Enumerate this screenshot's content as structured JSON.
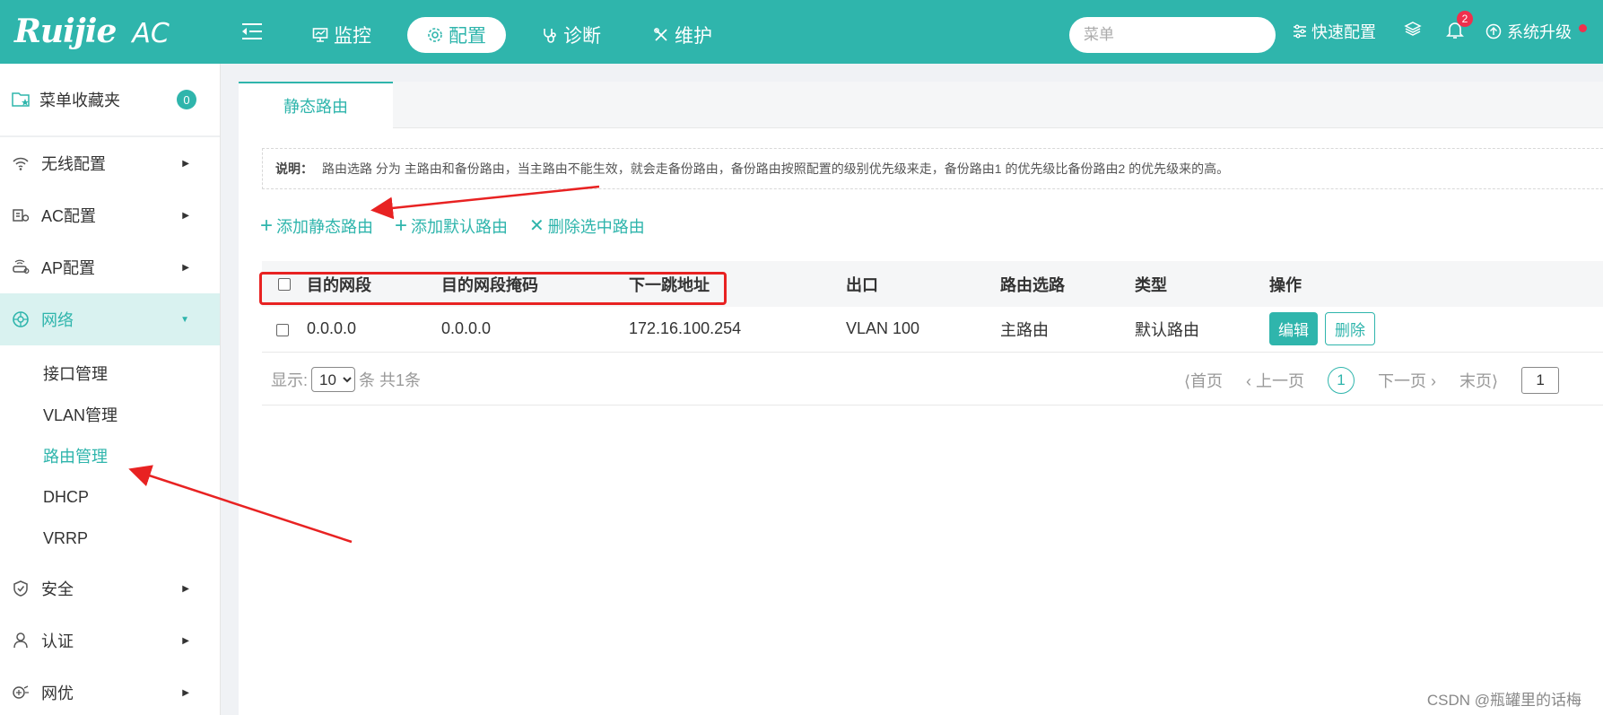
{
  "brand": {
    "logo": "Ruijie",
    "product": "AC"
  },
  "topnav": [
    {
      "label": "监控",
      "icon": "monitor-icon",
      "active": false
    },
    {
      "label": "配置",
      "icon": "gear-icon",
      "active": true
    },
    {
      "label": "诊断",
      "icon": "stethoscope-icon",
      "active": false
    },
    {
      "label": "维护",
      "icon": "tools-icon",
      "active": false
    }
  ],
  "search": {
    "placeholder": "菜单"
  },
  "toolbar": {
    "quick_config": "快速配置",
    "notification_count": "2",
    "upgrade": "系统升级"
  },
  "sidebar": {
    "favorites": {
      "label": "菜单收藏夹",
      "count": "0"
    },
    "items": [
      {
        "label": "无线配置"
      },
      {
        "label": "AC配置"
      },
      {
        "label": "AP配置"
      },
      {
        "label": "网络"
      },
      {
        "label": "安全"
      },
      {
        "label": "认证"
      },
      {
        "label": "网优"
      }
    ],
    "network_sub": [
      {
        "label": "接口管理"
      },
      {
        "label": "VLAN管理"
      },
      {
        "label": "路由管理"
      },
      {
        "label": "DHCP"
      },
      {
        "label": "VRRP"
      }
    ]
  },
  "main": {
    "tab": "静态路由",
    "notice_title": "说明：",
    "notice_text": "路由选路 分为 主路由和备份路由，当主路由不能生效，就会走备份路由，备份路由按照配置的级别优先级来走，备份路由1 的优先级比备份路由2 的优先级来的高。",
    "actions": {
      "add_static": "添加静态路由",
      "add_default": "添加默认路由",
      "delete_selected": "删除选中路由"
    },
    "table": {
      "columns": [
        "目的网段",
        "目的网段掩码",
        "下一跳地址",
        "出口",
        "路由选路",
        "类型",
        "操作"
      ],
      "rows": [
        {
          "dest": "0.0.0.0",
          "mask": "0.0.0.0",
          "nexthop": "172.16.100.254",
          "iface": "VLAN 100",
          "route_sel": "主路由",
          "type": "默认路由",
          "edit": "编辑",
          "delete": "删除"
        }
      ]
    },
    "pager": {
      "show_label": "显示:",
      "page_size": "10",
      "total_text": "条 共1条",
      "first": "首页",
      "prev": "上一页",
      "current": "1",
      "next": "下一页",
      "last": "末页",
      "goto_value": "1"
    }
  },
  "watermark": "CSDN @瓶罐里的话梅",
  "colors": {
    "brand": "#2fb5ac",
    "annotation": "#e82222",
    "badge": "#f0304d"
  }
}
